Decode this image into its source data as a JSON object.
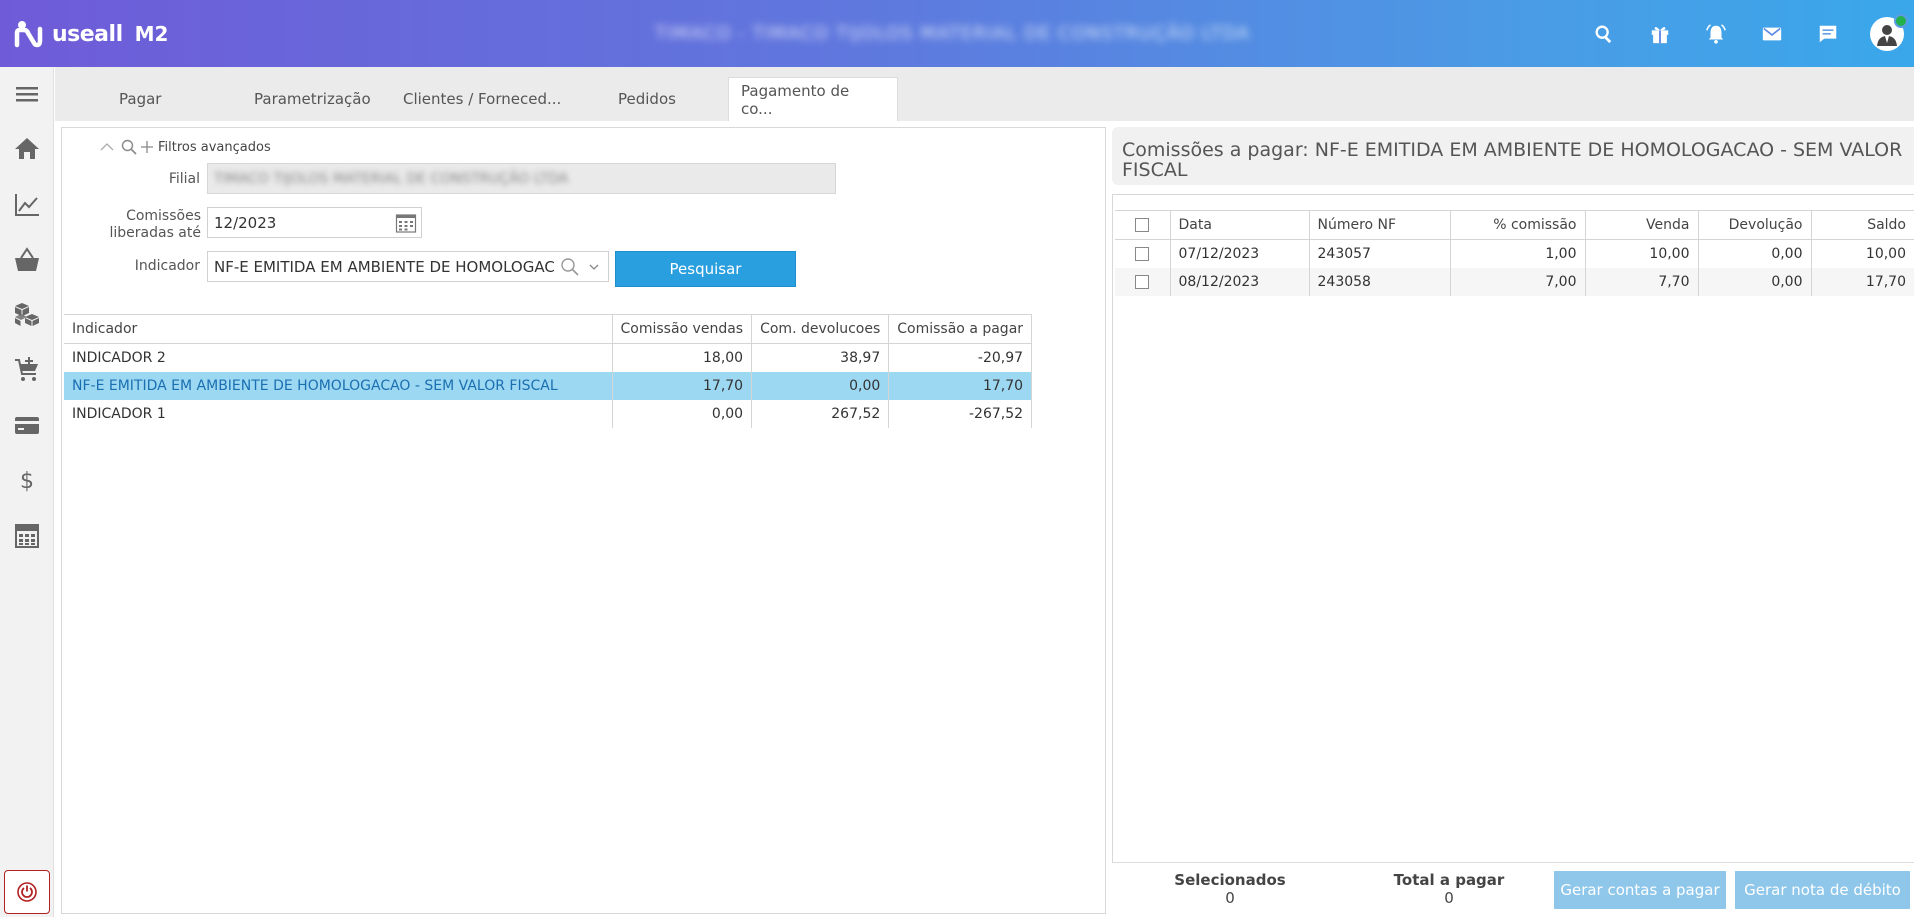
{
  "header": {
    "brand": "useall",
    "product": "M2",
    "company": "TIMACO - TIMACO TIJOLOS MATERIAL DE CONSTRUÇÃO LTDA",
    "icons": [
      "search-icon",
      "gift-icon",
      "bell-icon",
      "mail-icon",
      "chat-icon",
      "user-avatar"
    ]
  },
  "rail": {
    "items": [
      "menu-icon",
      "home-icon",
      "chart-icon",
      "basket-icon",
      "boxes-icon",
      "cart-add-icon",
      "card-icon",
      "dollar-icon",
      "calculator-icon",
      "power-icon"
    ]
  },
  "tabs": [
    {
      "label": "Pagar"
    },
    {
      "label": "Parametrização"
    },
    {
      "label": "Clientes / Forneced..."
    },
    {
      "label": "Pedidos"
    },
    {
      "label": "Pagamento de co..."
    }
  ],
  "filters": {
    "advanced_label": "Filtros avançados",
    "filial_label": "Filial",
    "filial_value": "TIMACO TIJOLOS MATERIAL DE CONSTRUÇÃO LTDA",
    "comissoes_label_1": "Comissões",
    "comissoes_label_2": "liberadas até",
    "comissoes_value": "12/2023",
    "indicador_label": "Indicador",
    "indicador_value": "NF-E EMITIDA EM AMBIENTE DE HOMOLOGACAO - SEM VALOR FISCAL",
    "search_button": "Pesquisar"
  },
  "left_table": {
    "headers": [
      "Indicador",
      "Comissão vendas",
      "Com. devolucoes",
      "Comissão a pagar"
    ],
    "rows": [
      {
        "indicador": "INDICADOR 2",
        "vendas": "18,00",
        "devolucoes": "38,97",
        "pagar": "-20,97"
      },
      {
        "indicador": "NF-E EMITIDA EM AMBIENTE DE HOMOLOGACAO - SEM VALOR FISCAL",
        "vendas": "17,70",
        "devolucoes": "0,00",
        "pagar": "17,70"
      },
      {
        "indicador": "INDICADOR 1",
        "vendas": "0,00",
        "devolucoes": "267,52",
        "pagar": "-267,52"
      }
    ]
  },
  "right": {
    "title": "Comissões a pagar: NF-E EMITIDA EM AMBIENTE DE HOMOLOGACAO - SEM VALOR FISCAL",
    "headers": [
      "Data",
      "Número NF",
      "% comissão",
      "Venda",
      "Devolução",
      "Saldo"
    ],
    "rows": [
      {
        "data": "07/12/2023",
        "nf": "243057",
        "comissao": "1,00",
        "venda": "10,00",
        "devolucao": "0,00",
        "saldo": "10,00"
      },
      {
        "data": "08/12/2023",
        "nf": "243058",
        "comissao": "7,00",
        "venda": "7,70",
        "devolucao": "0,00",
        "saldo": "17,70"
      }
    ],
    "footer": {
      "selecionados_label": "Selecionados",
      "selecionados_value": "0",
      "total_label": "Total a pagar",
      "total_value": "0",
      "btn_contas": "Gerar contas a pagar",
      "btn_nota": "Gerar nota de débito"
    }
  }
}
